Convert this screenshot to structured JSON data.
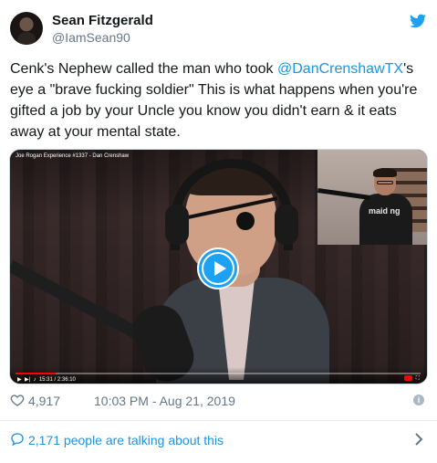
{
  "author": {
    "display_name": "Sean Fitzgerald",
    "handle": "@IamSean90"
  },
  "tweet": {
    "text_before": "Cenk's Nephew called the man who took ",
    "mention": "@DanCrenshawTX",
    "text_after": "'s eye a \"brave fucking soldier\" This is what happens when you're gifted a job by your Uncle you know you didn't earn & it eats away at your mental state."
  },
  "media": {
    "video_title": "Joe Rogan Experience #1337 - Dan Crenshaw",
    "time_readout": "15:31 / 2:36:10",
    "pip_shirt_text": "maid ng",
    "progress_fraction": 0.1
  },
  "meta": {
    "likes": "4,917",
    "timestamp": "10:03 PM - Aug 21, 2019"
  },
  "footer": {
    "talking": "2,171 people are talking about this"
  },
  "colors": {
    "link": "#1b95e0",
    "twitter_blue": "#1da1f2",
    "muted": "#657786"
  },
  "icons": [
    "twitter-bird-icon",
    "play-icon",
    "heart-icon",
    "info-icon",
    "speech-bubble-icon",
    "chevron-right-icon"
  ]
}
